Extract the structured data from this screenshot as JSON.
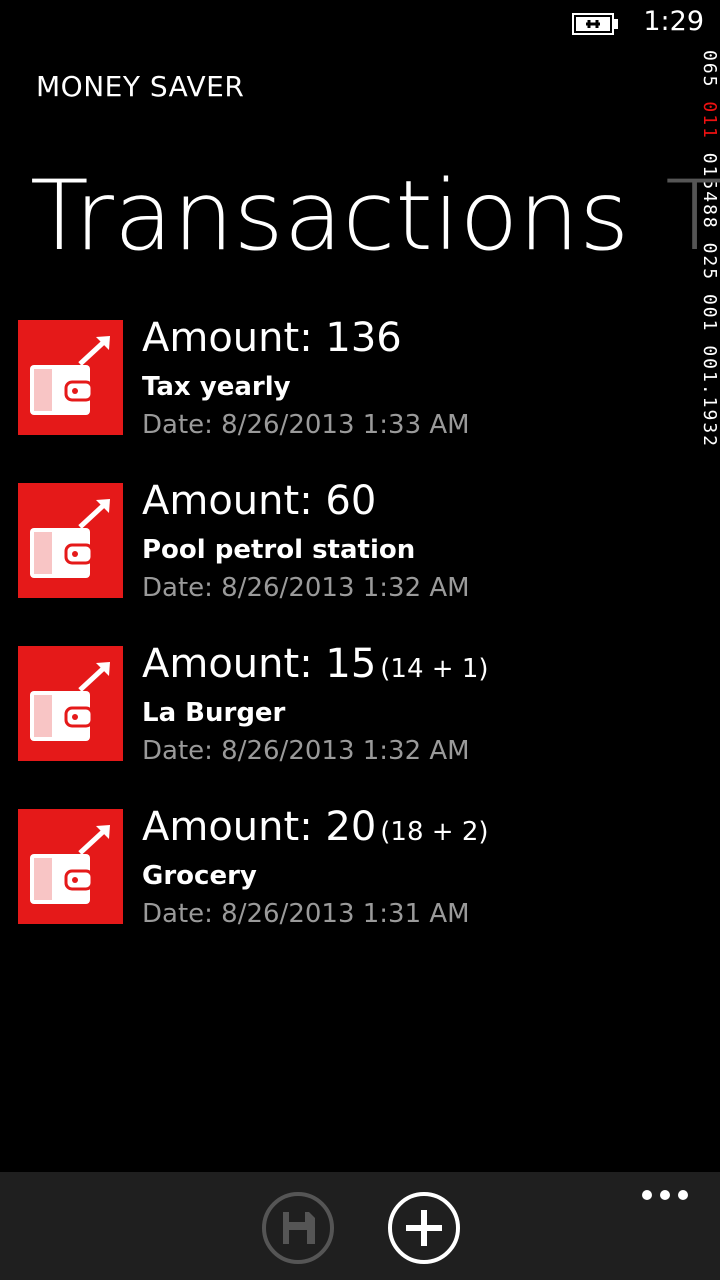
{
  "status_bar": {
    "battery_icon": "battery-charging-icon",
    "time": "1:29"
  },
  "app": {
    "title": "MONEY SAVER"
  },
  "pivot": {
    "active_header": "Transactions",
    "next_header": "Tr"
  },
  "debug_counters": {
    "line1": "065",
    "line2": "011",
    "line3": "015488",
    "line4": "025",
    "line5": "001",
    "line6": "001.1932"
  },
  "transactions": [
    {
      "amount_label": "Amount: 136",
      "breakdown": "",
      "description": "Tax yearly",
      "date": "Date: 8/26/2013 1:33 AM",
      "icon": "wallet-outgoing-icon"
    },
    {
      "amount_label": "Amount: 60",
      "breakdown": "",
      "description": "Pool petrol station",
      "date": "Date: 8/26/2013 1:32 AM",
      "icon": "wallet-outgoing-icon"
    },
    {
      "amount_label": "Amount: 15",
      "breakdown": "(14 + 1)",
      "description": "La Burger",
      "date": "Date: 8/26/2013 1:32 AM",
      "icon": "wallet-outgoing-icon"
    },
    {
      "amount_label": "Amount: 20",
      "breakdown": "(18 + 2)",
      "description": "Grocery",
      "date": "Date: 8/26/2013 1:31 AM",
      "icon": "wallet-outgoing-icon"
    }
  ],
  "app_bar": {
    "buttons": [
      {
        "icon": "save-icon",
        "enabled": false
      },
      {
        "icon": "add-icon",
        "enabled": true
      }
    ],
    "more_icon": "ellipsis-icon"
  },
  "colors": {
    "accent": "#e51919",
    "background": "#000000",
    "secondary_text": "#9a9a9a",
    "app_bar": "#1f1f1f"
  }
}
